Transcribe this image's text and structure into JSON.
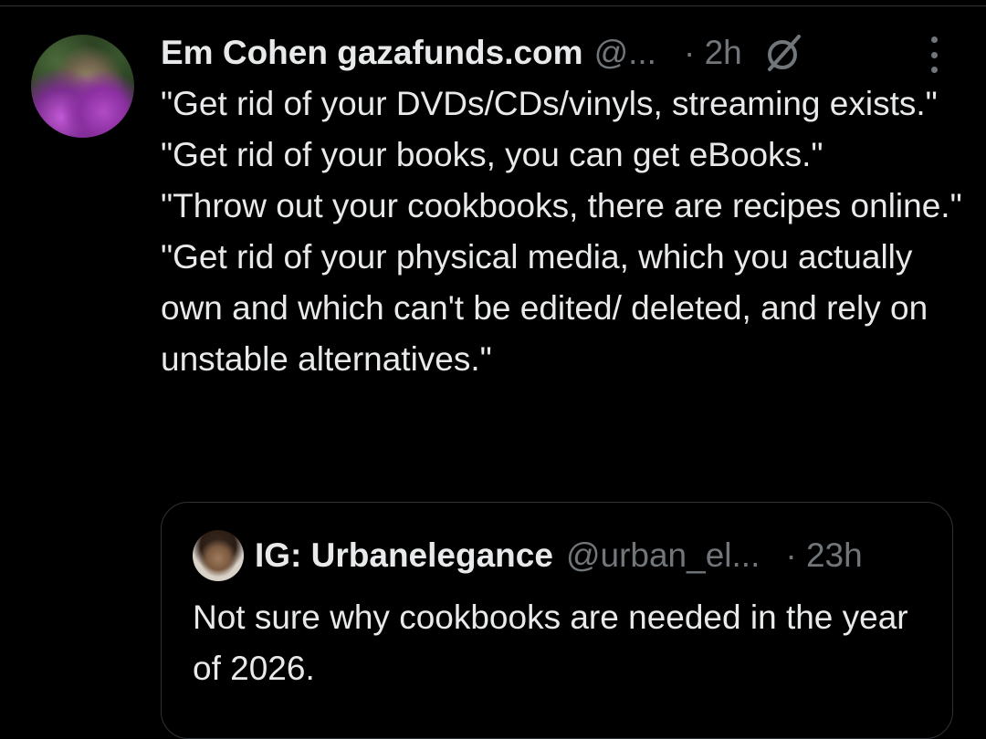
{
  "post": {
    "author_name": "Em Cohen gazafunds.com",
    "handle": "@...",
    "time": "· 2h",
    "grok_icon": "grok-icon",
    "more_icon": "more-options-icon",
    "body_lines": [
      "\"Get rid of your DVDs/CDs/vinyls, streaming exists.\"",
      "\"Get rid of your books, you can get eBooks.\"",
      "\"Throw out your cookbooks, there are recipes online.\"",
      "\"Get rid of your physical media, which you actually own and which can't be edited/ deleted, and rely on unstable alternatives.\""
    ]
  },
  "quoted_post": {
    "author_name": "IG: Urbanelegance",
    "handle": "@urban_el...",
    "time": "· 23h",
    "body": "Not sure why cookbooks are needed in the year of 2026."
  },
  "colors": {
    "background": "#000000",
    "text_primary": "#e7e9ea",
    "text_secondary": "#71767b",
    "border": "#2f3336"
  }
}
